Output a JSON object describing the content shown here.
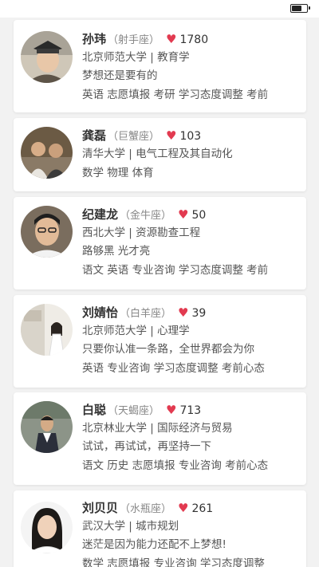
{
  "status_bar": {
    "battery_level": 0.6
  },
  "mentors": [
    {
      "name": "孙玮",
      "sign": "（射手座）",
      "likes": "1780",
      "school_major": "北京师范大学 | 教育学",
      "motto": "梦想还是要有的",
      "tags": "英语 志愿填报 考研 学习态度调整 考前"
    },
    {
      "name": "龚磊",
      "sign": "（巨蟹座）",
      "likes": "103",
      "school_major": "清华大学 | 电气工程及其自动化",
      "motto": "",
      "tags": "数学 物理 体育"
    },
    {
      "name": "纪建龙",
      "sign": "（金牛座）",
      "likes": "50",
      "school_major": "西北大学 | 资源勘查工程",
      "motto": "路够黑 光才亮",
      "tags": "语文 英语 专业咨询 学习态度调整 考前"
    },
    {
      "name": "刘婧怡",
      "sign": "（白羊座）",
      "likes": "39",
      "school_major": "北京师范大学 | 心理学",
      "motto": "只要你认准一条路，全世界都会为你",
      "tags": "英语 专业咨询 学习态度调整 考前心态"
    },
    {
      "name": "白聪",
      "sign": "（天蝎座）",
      "likes": "713",
      "school_major": "北京林业大学 | 国际经济与贸易",
      "motto": "试试，再试试，再坚持一下",
      "tags": "语文 历史 志愿填报 专业咨询 考前心态"
    },
    {
      "name": "刘贝贝",
      "sign": "（水瓶座）",
      "likes": "261",
      "school_major": "武汉大学 | 城市规划",
      "motto": "迷茫是因为能力还配不上梦想!",
      "tags": "数学 志愿填报 专业咨询 学习态度调整"
    }
  ]
}
